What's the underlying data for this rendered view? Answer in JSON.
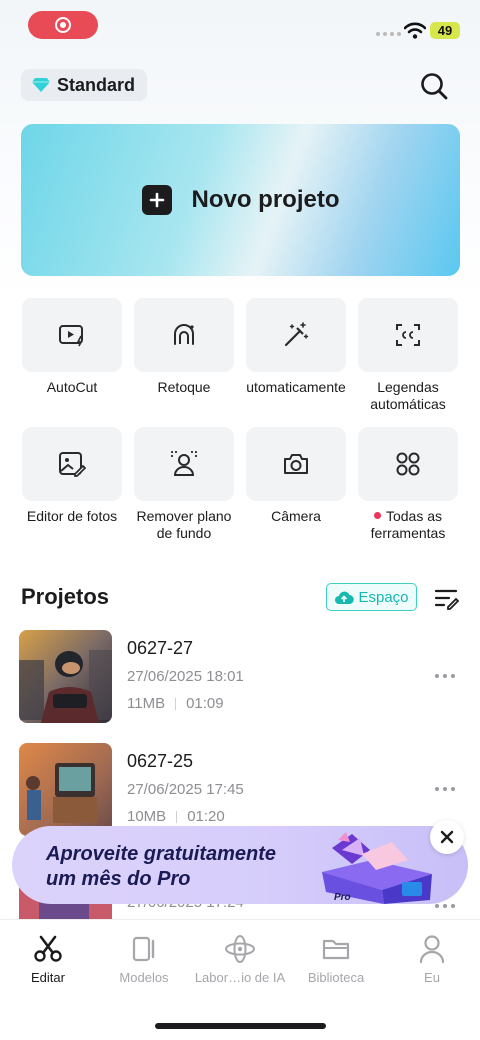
{
  "status_bar": {
    "battery": "49"
  },
  "header": {
    "plan_label": "Standard"
  },
  "new_project": {
    "label": "Novo projeto"
  },
  "tools": [
    {
      "label": "AutoCut",
      "icon": "autocut-icon"
    },
    {
      "label": "Retoque",
      "icon": "retouch-icon"
    },
    {
      "label": "utomaticamente",
      "icon": "magic-wand-icon"
    },
    {
      "label": "Legendas automáticas",
      "icon": "captions-icon"
    },
    {
      "label": "Editor de fotos",
      "icon": "photo-edit-icon"
    },
    {
      "label": "Remover plano de fundo",
      "icon": "remove-bg-icon"
    },
    {
      "label": "Câmera",
      "icon": "camera-icon"
    },
    {
      "label": "Todas as ferramentas",
      "icon": "grid-icon"
    }
  ],
  "projects": {
    "title": "Projetos",
    "space_label": "Espaço",
    "items": [
      {
        "name": "0627-27",
        "date": "27/06/2025 18:01",
        "size": "11MB",
        "duration": "01:09"
      },
      {
        "name": "0627-25",
        "date": "27/06/2025 17:45",
        "size": "10MB",
        "duration": "01:20"
      },
      {
        "name": "",
        "date": "27/06/2025 17:24",
        "size": "",
        "duration": ""
      }
    ]
  },
  "promo": {
    "line1": "Aproveite gratuitamente",
    "line2": "um mês do Pro",
    "art_label": "Pro"
  },
  "bottom_nav": [
    {
      "label": "Editar",
      "icon": "scissors-icon",
      "active": true
    },
    {
      "label": "Modelos",
      "icon": "templates-icon",
      "active": false
    },
    {
      "label": "Labor…io de IA",
      "icon": "ai-lab-icon",
      "active": false
    },
    {
      "label": "Biblioteca",
      "icon": "folder-icon",
      "active": false
    },
    {
      "label": "Eu",
      "icon": "profile-icon",
      "active": false
    }
  ],
  "colors": {
    "accent": "#16b8b0",
    "record": "#e84b55",
    "promo_text": "#1a1a55"
  }
}
